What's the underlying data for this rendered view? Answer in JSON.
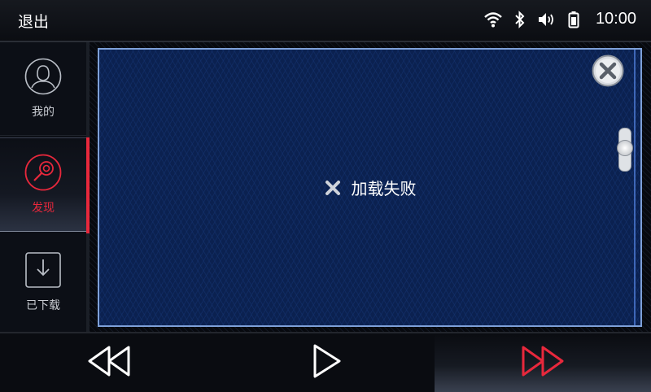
{
  "statusbar": {
    "exit_label": "退出",
    "time": "10:00",
    "icons": [
      "wifi-icon",
      "bluetooth-icon",
      "volume-icon",
      "battery-icon"
    ]
  },
  "sidebar": {
    "items": [
      {
        "label": "我的",
        "icon": "user-icon",
        "active": false
      },
      {
        "label": "发现",
        "icon": "discover-icon",
        "active": true
      },
      {
        "label": "已下载",
        "icon": "download-icon",
        "active": false
      }
    ]
  },
  "content": {
    "error_text": "加载失败"
  },
  "player": {
    "controls": [
      "rewind",
      "play",
      "fast-forward"
    ],
    "active_control": "fast-forward"
  },
  "colors": {
    "accent": "#e8283c",
    "panel_bg": "#0b2150",
    "panel_border": "#7ea0d8"
  }
}
